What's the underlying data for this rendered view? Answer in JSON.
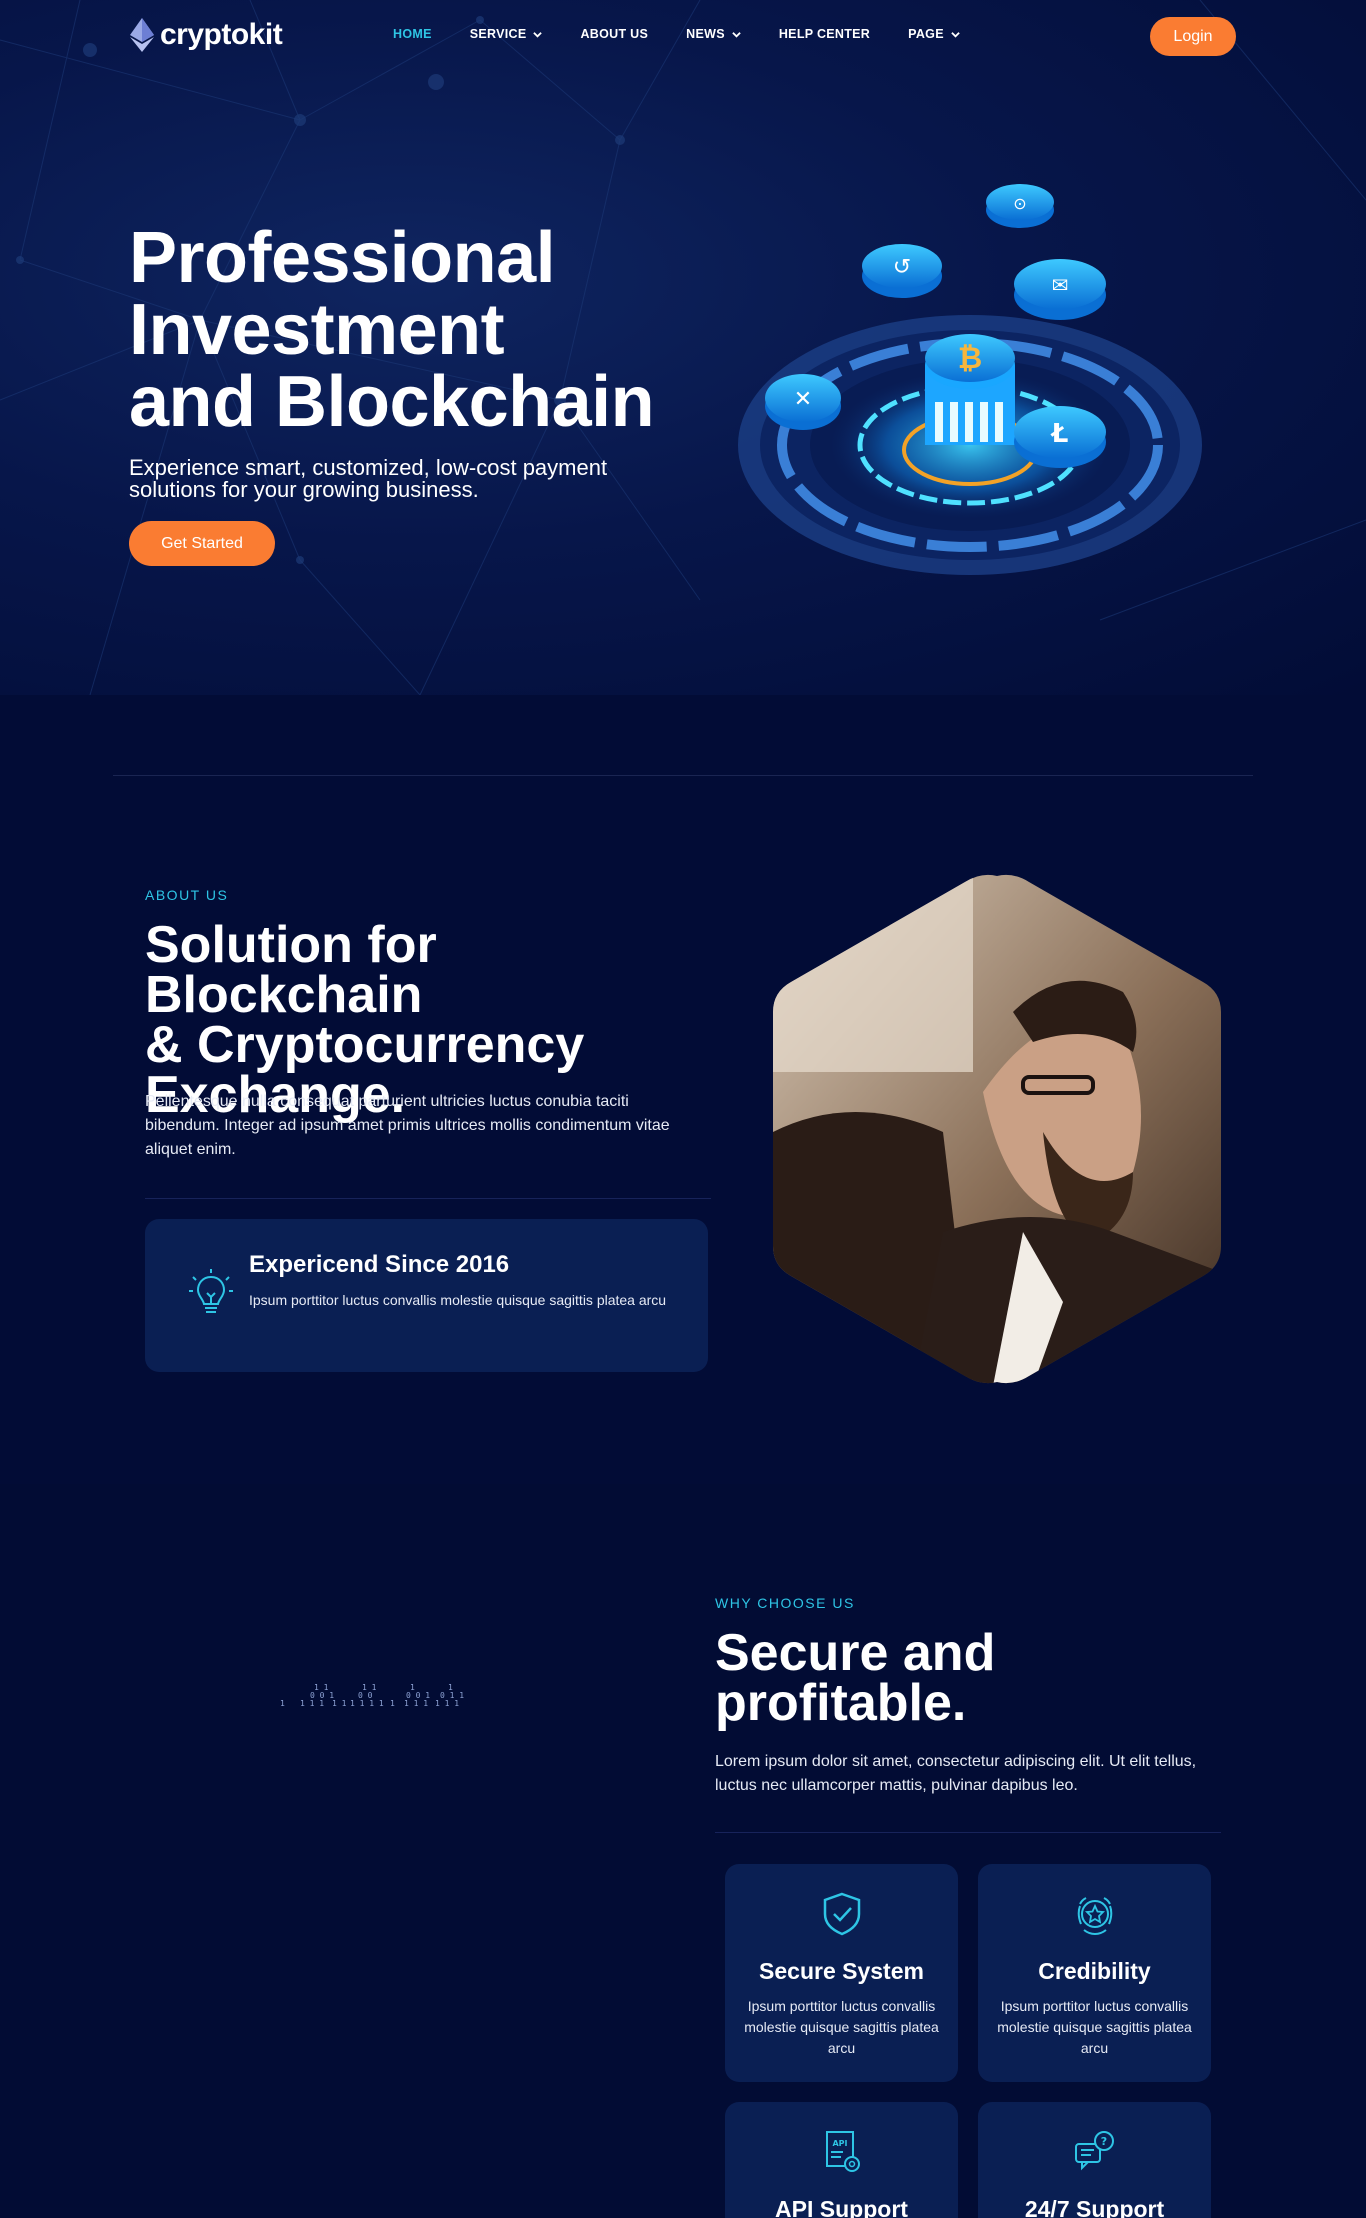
{
  "brand": {
    "name": "cryptokit"
  },
  "nav": {
    "items": [
      {
        "label": "HOME",
        "active": true,
        "dropdown": false
      },
      {
        "label": "SERVICE",
        "active": false,
        "dropdown": true
      },
      {
        "label": "ABOUT US",
        "active": false,
        "dropdown": false
      },
      {
        "label": "NEWS",
        "active": false,
        "dropdown": true
      },
      {
        "label": "HELP CENTER",
        "active": false,
        "dropdown": false
      },
      {
        "label": "PAGE",
        "active": false,
        "dropdown": true
      }
    ],
    "login_label": "Login"
  },
  "hero": {
    "title_lines": [
      "Professional",
      "Investment",
      "and Blockchain"
    ],
    "subtitle_lines": [
      "Experience smart, customized, low-cost payment",
      "solutions for your growing business."
    ],
    "cta_label": "Get Started"
  },
  "about": {
    "eyebrow": "ABOUT US",
    "title_lines": [
      "Solution for Blockchain",
      "& Cryptocurrency",
      "Exchange."
    ],
    "text": "Pellentesque nulla consequat parturient ultricies luctus conubia taciti bibendum. Integer ad ipsum amet primis ultrices mollis condimentum vitae aliquet enim.",
    "card": {
      "title": "Expericend Since 2016",
      "text": "Ipsum porttitor luctus convallis molestie quisque sagittis platea arcu",
      "icon": "lightbulb-icon"
    }
  },
  "why": {
    "eyebrow": "WHY CHOOSE US",
    "title_lines": [
      "Secure and",
      "profitable."
    ],
    "text": "Lorem ipsum dolor sit amet, consectetur adipiscing elit. Ut elit tellus, luctus nec ullamcorper mattis, pulvinar dapibus leo.",
    "features": [
      {
        "title": "Secure System",
        "text": "Ipsum porttitor luctus convallis molestie quisque sagittis platea arcu",
        "icon": "shield-check-icon"
      },
      {
        "title": "Credibility",
        "text": "Ipsum porttitor luctus convallis molestie quisque sagittis platea arcu",
        "icon": "badge-star-icon"
      },
      {
        "title": "API Support",
        "text": "",
        "icon": "api-gear-icon"
      },
      {
        "title": "24/7 Support",
        "text": "",
        "icon": "chat-question-icon"
      }
    ]
  },
  "colors": {
    "background": "#020c36",
    "accent_cyan": "#2ec5e5",
    "accent_orange": "#fa7c32",
    "card": "#0a1f53"
  }
}
